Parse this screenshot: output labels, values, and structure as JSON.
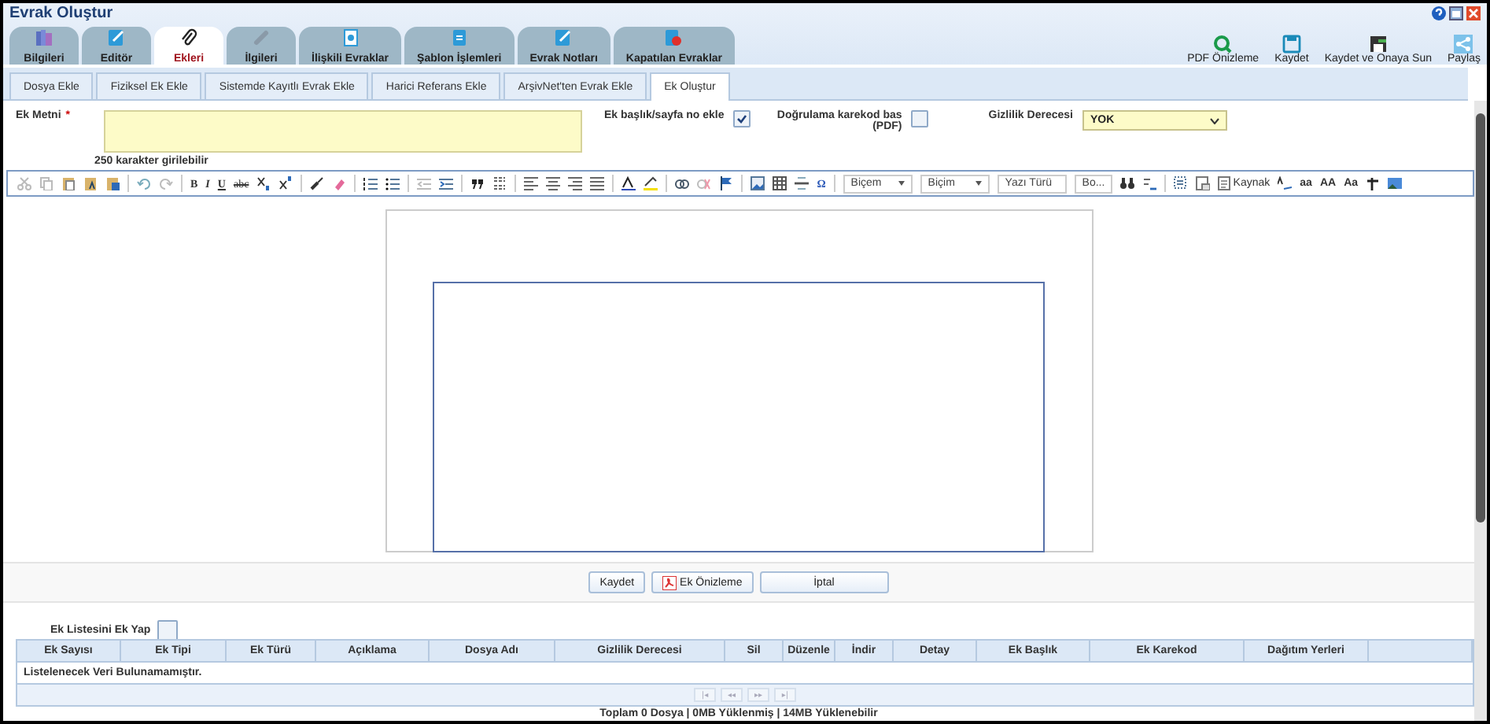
{
  "window": {
    "title": "Evrak Oluştur"
  },
  "main_tabs": [
    {
      "label": "Bilgileri",
      "selected": false
    },
    {
      "label": "Editör",
      "selected": false
    },
    {
      "label": "Ekleri",
      "selected": true
    },
    {
      "label": "İlgileri",
      "selected": false
    },
    {
      "label": "İlişkili Evraklar",
      "selected": false
    },
    {
      "label": "Şablon İşlemleri",
      "selected": false
    },
    {
      "label": "Evrak Notları",
      "selected": false
    },
    {
      "label": "Kapatılan Evraklar",
      "selected": false
    }
  ],
  "actions": [
    "PDF Önizleme",
    "Kaydet",
    "Kaydet ve Onaya Sun",
    "Paylaş"
  ],
  "sub_tabs": [
    {
      "label": "Dosya Ekle",
      "selected": false
    },
    {
      "label": "Fiziksel Ek Ekle",
      "selected": false
    },
    {
      "label": "Sistemde Kayıtlı Evrak Ekle",
      "selected": false
    },
    {
      "label": "Harici Referans Ekle",
      "selected": false
    },
    {
      "label": "ArşivNet'ten Evrak Ekle",
      "selected": false
    },
    {
      "label": "Ek Oluştur",
      "selected": true
    }
  ],
  "form": {
    "ek_metni_label": "Ek Metni",
    "required_mark": "*",
    "ek_metni_hint": "250 karakter girilebilir",
    "header_option": {
      "label": "Ek başlık/sayfa no ekle",
      "checked": true
    },
    "qr_option": {
      "label": "Doğrulama karekod bas (PDF)",
      "checked": false
    },
    "gizlilik_label": "Gizlilik Derecesi",
    "gizlilik_value": "YOK"
  },
  "toolbar": {
    "text_buttons": [
      "B",
      "I",
      "U",
      "abc"
    ],
    "dropdowns": [
      "Biçem",
      "Biçim",
      "Yazı Türü",
      "Bo..."
    ],
    "symbol_button": "Ω",
    "source_button": "Kaynak",
    "case_buttons": [
      "aa",
      "AA",
      "Aa"
    ]
  },
  "buttons": [
    "Kaydet",
    "Ek Önizleme",
    "İptal"
  ],
  "list_option": {
    "label": "Ek Listesini Ek Yap",
    "checked": false
  },
  "table": {
    "columns": [
      "Ek Sayısı",
      "Ek Tipi",
      "Ek Türü",
      "Açıklama",
      "Dosya Adı",
      "Gizlilik Derecesi",
      "Sil",
      "Düzenle",
      "İndir",
      "Detay",
      "Ek Başlık",
      "Ek Karekod",
      "Dağıtım Yerleri"
    ],
    "empty_message": "Listelenecek Veri Bulunamamıştır.",
    "pager": [
      "|◂",
      "◂◂",
      "▸▸",
      "▸|"
    ]
  },
  "status_bar": "Toplam 0 Dosya | 0MB Yüklenmiş | 14MB Yüklenebilir"
}
